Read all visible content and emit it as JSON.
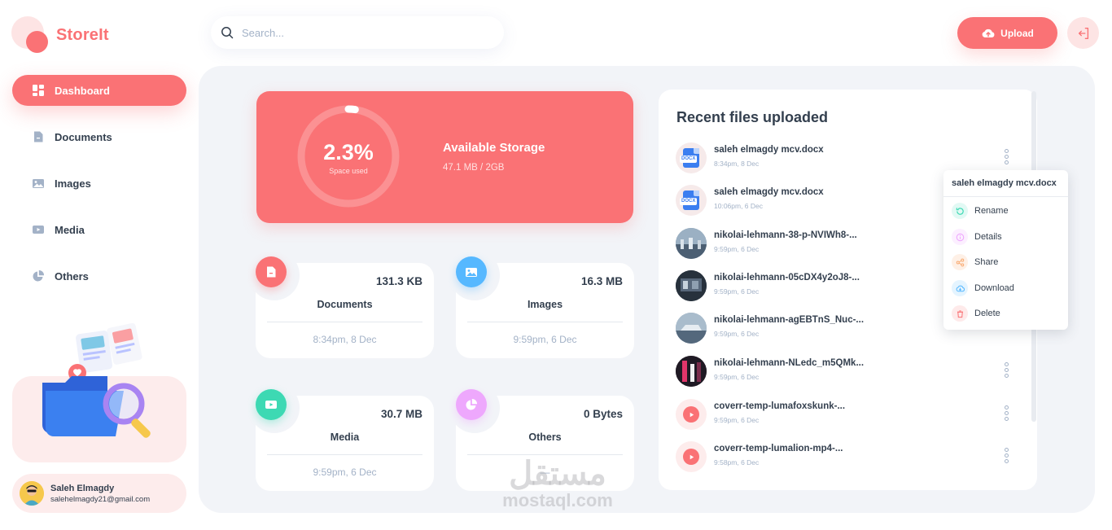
{
  "app": {
    "name": "StoreIt"
  },
  "search": {
    "placeholder": "Search..."
  },
  "header": {
    "upload_label": "Upload"
  },
  "sidebar": {
    "items": [
      {
        "label": "Dashboard",
        "icon": "dashboard-icon",
        "active": true
      },
      {
        "label": "Documents",
        "icon": "documents-icon",
        "active": false
      },
      {
        "label": "Images",
        "icon": "images-icon",
        "active": false
      },
      {
        "label": "Media",
        "icon": "video-icon",
        "active": false
      },
      {
        "label": "Others",
        "icon": "pie-icon",
        "active": false
      }
    ]
  },
  "user": {
    "name": "Saleh Elmagdy",
    "email": "salehelmagdy21@gmail.com"
  },
  "storage": {
    "percent_label": "2.3%",
    "percent_value": 2.3,
    "caption": "Space used",
    "title": "Available Storage",
    "used": "47.1 MB",
    "separator": "/",
    "total": "2GB"
  },
  "summary": [
    {
      "title": "Documents",
      "size": "131.3 KB",
      "date": "8:34pm, 8 Dec",
      "icon": "file-icon",
      "color": "#fa7275"
    },
    {
      "title": "Images",
      "size": "16.3 MB",
      "date": "9:59pm, 6 Dec",
      "icon": "image-icon",
      "color": "#56b8ff"
    },
    {
      "title": "Media",
      "size": "30.7 MB",
      "date": "9:59pm, 6 Dec",
      "icon": "video-icon",
      "color": "#3dd9b3"
    },
    {
      "title": "Others",
      "size": "0 Bytes",
      "date": "—",
      "icon": "pie-icon",
      "color": "#eea8fd"
    }
  ],
  "recent": {
    "title": "Recent files uploaded",
    "files": [
      {
        "name": "saleh elmagdy mcv.docx",
        "date": "8:34pm, 8 Dec",
        "type": "docx"
      },
      {
        "name": "saleh elmagdy mcv.docx",
        "date": "10:06pm, 6 Dec",
        "type": "docx"
      },
      {
        "name": "nikolai-lehmann-38-p-NVIWh8-...",
        "date": "9:59pm, 6 Dec",
        "type": "image",
        "thumb": "#7e93a8"
      },
      {
        "name": "nikolai-lehmann-05cDX4y2oJ8-...",
        "date": "9:59pm, 6 Dec",
        "type": "image",
        "thumb": "#2a3340"
      },
      {
        "name": "nikolai-lehmann-agEBTnS_Nuc-...",
        "date": "9:59pm, 6 Dec",
        "type": "image",
        "thumb": "#8fa3b5"
      },
      {
        "name": "nikolai-lehmann-NLedc_m5QMk...",
        "date": "9:59pm, 6 Dec",
        "type": "image",
        "thumb": "#3a1f2e"
      },
      {
        "name": "coverr-temp-lumafoxskunk-...",
        "date": "9:59pm, 6 Dec",
        "type": "video"
      },
      {
        "name": "coverr-temp-lumalion-mp4-...",
        "date": "9:58pm, 6 Dec",
        "type": "video"
      }
    ]
  },
  "context_menu": {
    "title": "saleh elmagdy mcv.docx",
    "items": [
      {
        "label": "Rename",
        "icon": "rename-icon",
        "color": "#3dd9b3"
      },
      {
        "label": "Details",
        "icon": "info-icon",
        "color": "#eea8fd"
      },
      {
        "label": "Share",
        "icon": "share-icon",
        "color": "#f9ab72"
      },
      {
        "label": "Download",
        "icon": "download-icon",
        "color": "#56b8ff"
      },
      {
        "label": "Delete",
        "icon": "trash-icon",
        "color": "#fa7275"
      }
    ]
  },
  "watermark": {
    "arabic": "مستقل",
    "latin": "mostaql.com"
  }
}
